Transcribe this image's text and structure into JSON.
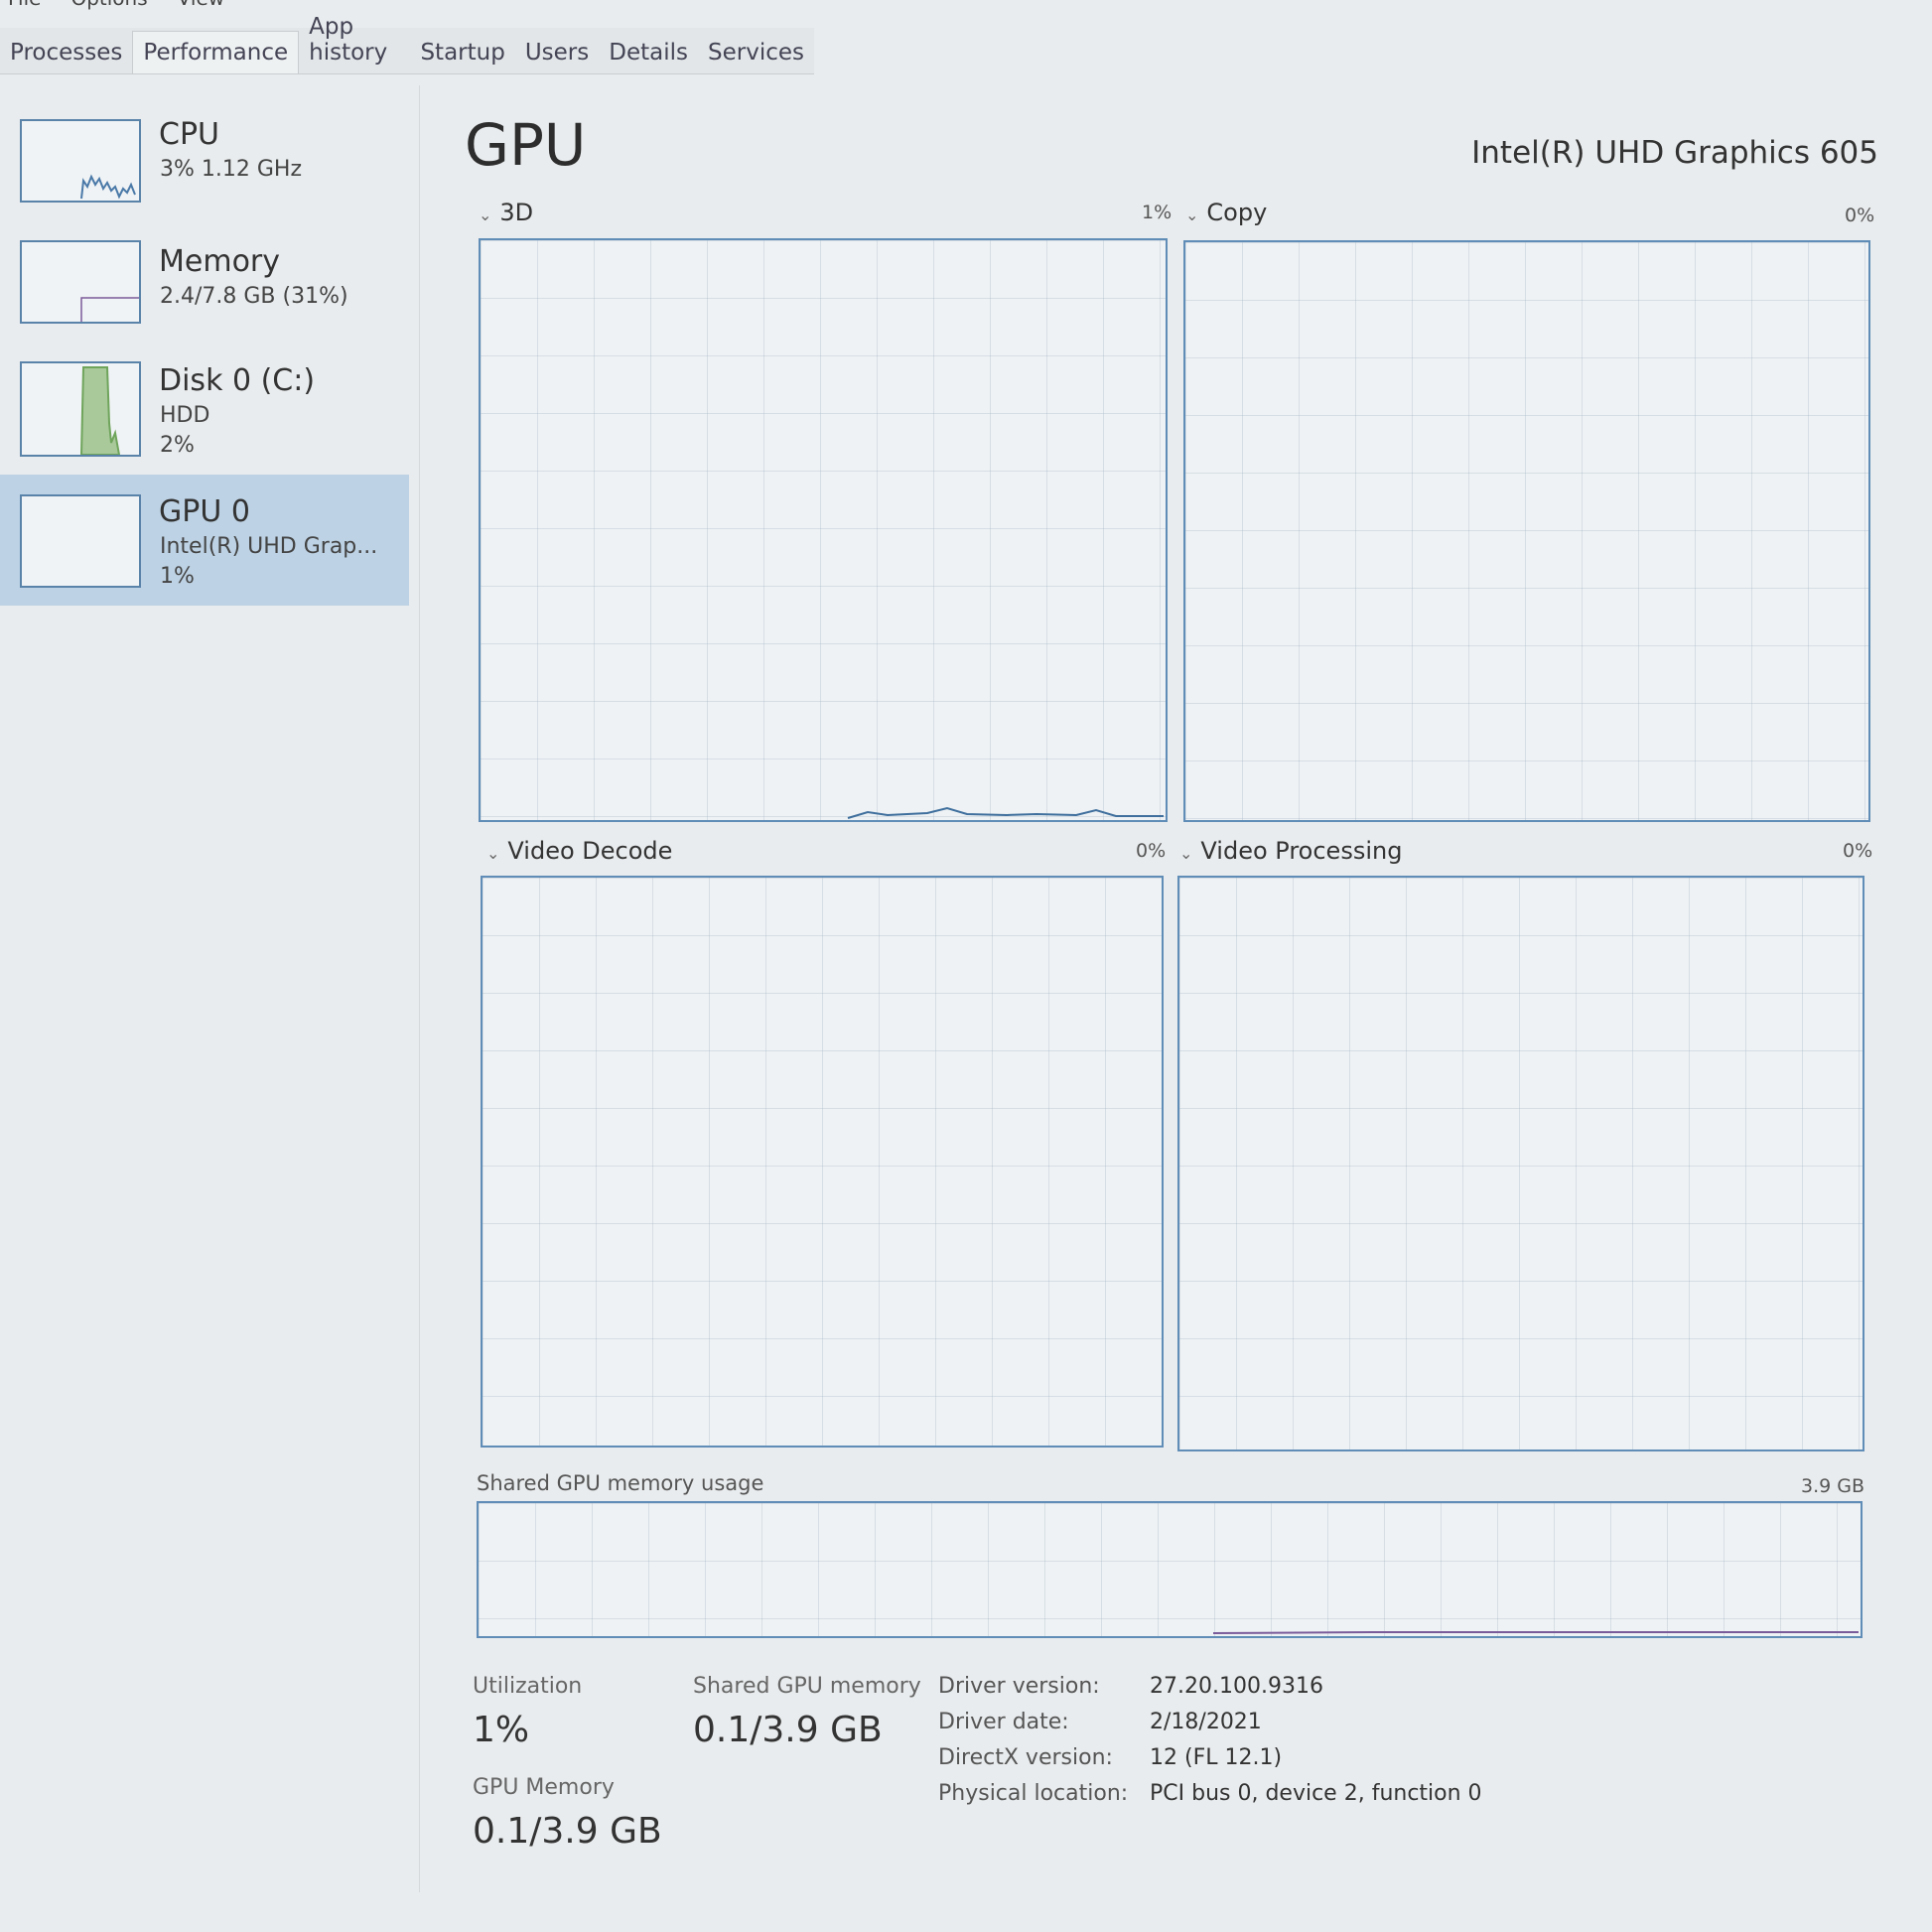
{
  "menu": [
    "File",
    "Options",
    "View"
  ],
  "tabs": [
    "Processes",
    "Performance",
    "App history",
    "Startup",
    "Users",
    "Details",
    "Services"
  ],
  "active_tab": "Performance",
  "sidebar": {
    "items": [
      {
        "title": "CPU",
        "line1": "3% 1.12 GHz",
        "line2": ""
      },
      {
        "title": "Memory",
        "line1": "2.4/7.8 GB (31%)",
        "line2": ""
      },
      {
        "title": "Disk 0 (C:)",
        "line1": "HDD",
        "line2": "2%"
      },
      {
        "title": "GPU 0",
        "line1": "Intel(R) UHD Grap...",
        "line2": "1%"
      }
    ]
  },
  "header": {
    "title": "GPU",
    "device": "Intel(R) UHD Graphics 605"
  },
  "panels": {
    "p3d": {
      "label": "3D",
      "pct": "1%"
    },
    "copy": {
      "label": "Copy",
      "pct": "0%"
    },
    "decode": {
      "label": "Video Decode",
      "pct": "0%"
    },
    "processing": {
      "label": "Video Processing",
      "pct": "0%"
    }
  },
  "shared": {
    "label": "Shared GPU memory usage",
    "max": "3.9 GB"
  },
  "stats": {
    "utilization_label": "Utilization",
    "utilization_value": "1%",
    "shared_label": "Shared GPU memory",
    "shared_value": "0.1/3.9 GB",
    "gpu_mem_label": "GPU Memory",
    "gpu_mem_value": "0.1/3.9 GB"
  },
  "info": {
    "driver_version_key": "Driver version:",
    "driver_version": "27.20.100.9316",
    "driver_date_key": "Driver date:",
    "driver_date": "2/18/2021",
    "directx_key": "DirectX version:",
    "directx": "12 (FL 12.1)",
    "location_key": "Physical location:",
    "location": "PCI bus 0, device 2, function 0"
  },
  "colors": {
    "accent": "#5f8db7",
    "selected": "#bdd2e4",
    "disk": "#6fa45b"
  }
}
